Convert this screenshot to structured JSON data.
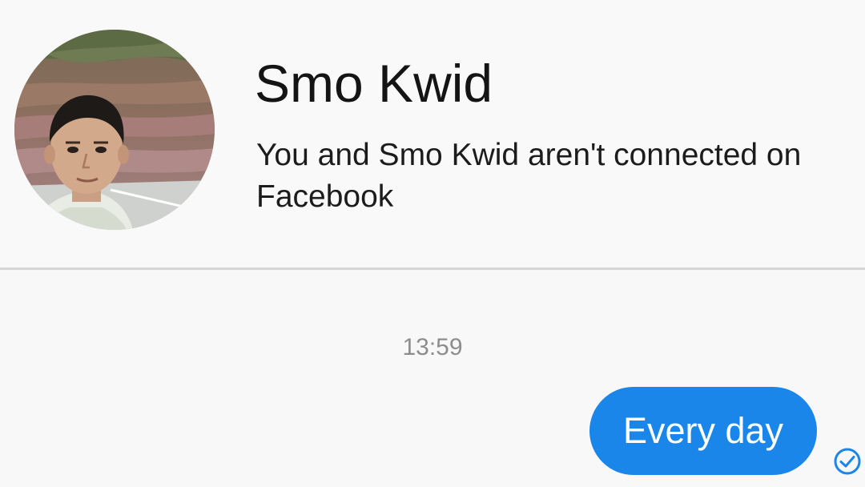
{
  "header": {
    "contact_name": "Smo Kwid",
    "connection_note": "You and Smo Kwid aren't connected on Facebook",
    "avatar_icon": "profile-photo"
  },
  "conversation": {
    "timestamp": "13:59",
    "messages": [
      {
        "text": "Every day",
        "direction": "outgoing",
        "status_icon": "delivered-check-icon"
      }
    ]
  },
  "colors": {
    "bubble": "#1b86ea",
    "background": "#f8f8f8",
    "divider": "#d6d6d6",
    "timestamp": "#8d8d8d",
    "status": "#1b86ea"
  }
}
